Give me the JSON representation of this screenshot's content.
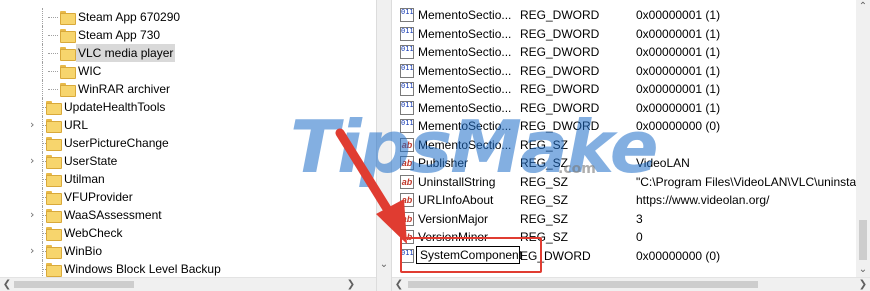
{
  "tree": {
    "items": [
      {
        "label": "Steam App 670290",
        "level": 2,
        "expandable": false,
        "selected": false
      },
      {
        "label": "Steam App 730",
        "level": 2,
        "expandable": false,
        "selected": false
      },
      {
        "label": "VLC media player",
        "level": 2,
        "expandable": false,
        "selected": true
      },
      {
        "label": "WIC",
        "level": 2,
        "expandable": false,
        "selected": false
      },
      {
        "label": "WinRAR archiver",
        "level": 2,
        "expandable": false,
        "selected": false
      },
      {
        "label": "UpdateHealthTools",
        "level": 1,
        "expandable": false,
        "selected": false
      },
      {
        "label": "URL",
        "level": 1,
        "expandable": true,
        "selected": false
      },
      {
        "label": "UserPictureChange",
        "level": 1,
        "expandable": false,
        "selected": false
      },
      {
        "label": "UserState",
        "level": 1,
        "expandable": true,
        "selected": false
      },
      {
        "label": "Utilman",
        "level": 1,
        "expandable": false,
        "selected": false
      },
      {
        "label": "VFUProvider",
        "level": 1,
        "expandable": false,
        "selected": false
      },
      {
        "label": "WaaSAssessment",
        "level": 1,
        "expandable": true,
        "selected": false
      },
      {
        "label": "WebCheck",
        "level": 1,
        "expandable": false,
        "selected": false
      },
      {
        "label": "WinBio",
        "level": 1,
        "expandable": true,
        "selected": false
      },
      {
        "label": "Windows Block Level Backup",
        "level": 1,
        "expandable": false,
        "selected": false
      }
    ]
  },
  "values": {
    "rows": [
      {
        "icon": "dword",
        "name": "MementoSectio...",
        "type": "REG_DWORD",
        "data": "0x00000001 (1)"
      },
      {
        "icon": "dword",
        "name": "MementoSectio...",
        "type": "REG_DWORD",
        "data": "0x00000001 (1)"
      },
      {
        "icon": "dword",
        "name": "MementoSectio...",
        "type": "REG_DWORD",
        "data": "0x00000001 (1)"
      },
      {
        "icon": "dword",
        "name": "MementoSectio...",
        "type": "REG_DWORD",
        "data": "0x00000001 (1)"
      },
      {
        "icon": "dword",
        "name": "MementoSectio...",
        "type": "REG_DWORD",
        "data": "0x00000001 (1)"
      },
      {
        "icon": "dword",
        "name": "MementoSectio...",
        "type": "REG_DWORD",
        "data": "0x00000001 (1)"
      },
      {
        "icon": "dword",
        "name": "MementoSectio...",
        "type": "REG_DWORD",
        "data": "0x00000000 (0)"
      },
      {
        "icon": "sz",
        "name": "MementoSectio...",
        "type": "REG_SZ",
        "data": ""
      },
      {
        "icon": "sz",
        "name": "Publisher",
        "type": "REG_SZ",
        "data": "VideoLAN"
      },
      {
        "icon": "sz",
        "name": "UninstallString",
        "type": "REG_SZ",
        "data": "\"C:\\Program Files\\VideoLAN\\VLC\\uninstall.e"
      },
      {
        "icon": "sz",
        "name": "URLInfoAbout",
        "type": "REG_SZ",
        "data": "https://www.videolan.org/"
      },
      {
        "icon": "sz",
        "name": "VersionMajor",
        "type": "REG_SZ",
        "data": "3"
      },
      {
        "icon": "sz",
        "name": "VersionMinor",
        "type": "REG_SZ",
        "data": "0"
      },
      {
        "icon": "dword",
        "name": "",
        "type": "EG_DWORD",
        "data": "0x00000000 (0)"
      }
    ],
    "rename_value": "SystemComponent"
  },
  "watermark": {
    "text": "TipsMake",
    "sub": ".com"
  },
  "colors": {
    "highlight": "#e03c31",
    "selection": "#d9d9d9",
    "folder": "#f7d56d"
  }
}
